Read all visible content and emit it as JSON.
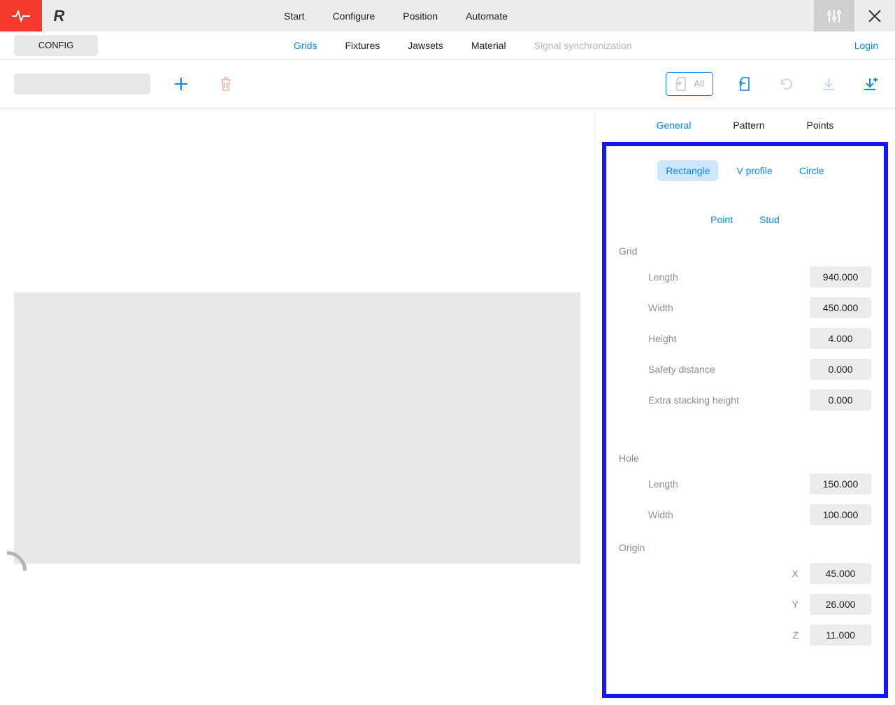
{
  "topnav": {
    "start": "Start",
    "configure": "Configure",
    "position": "Position",
    "automate": "Automate"
  },
  "secbar": {
    "config": "CONFIG",
    "grids": "Grids",
    "fixtures": "Fixtures",
    "jawsets": "Jawsets",
    "material": "Material",
    "signal_sync": "Signal synchronization",
    "login": "Login"
  },
  "toolbar": {
    "all": "All"
  },
  "panel": {
    "tabs": {
      "general": "General",
      "pattern": "Pattern",
      "points": "Points"
    },
    "shapes": {
      "rectangle": "Rectangle",
      "vprofile": "V profile",
      "circle": "Circle",
      "point": "Point",
      "stud": "Stud"
    },
    "sections": {
      "grid": {
        "title": "Grid",
        "length_label": "Length",
        "length": "940.000",
        "width_label": "Width",
        "width": "450.000",
        "height_label": "Height",
        "height": "4.000",
        "safety_label": "Safety distance",
        "safety": "0.000",
        "extra_label": "Extra stacking height",
        "extra": "0.000"
      },
      "hole": {
        "title": "Hole",
        "length_label": "Length",
        "length": "150.000",
        "width_label": "Width",
        "width": "100.000"
      },
      "origin": {
        "title": "Origin",
        "x_label": "X",
        "x": "45.000",
        "y_label": "Y",
        "y": "26.000",
        "z_label": "Z",
        "z": "11.000"
      }
    }
  }
}
